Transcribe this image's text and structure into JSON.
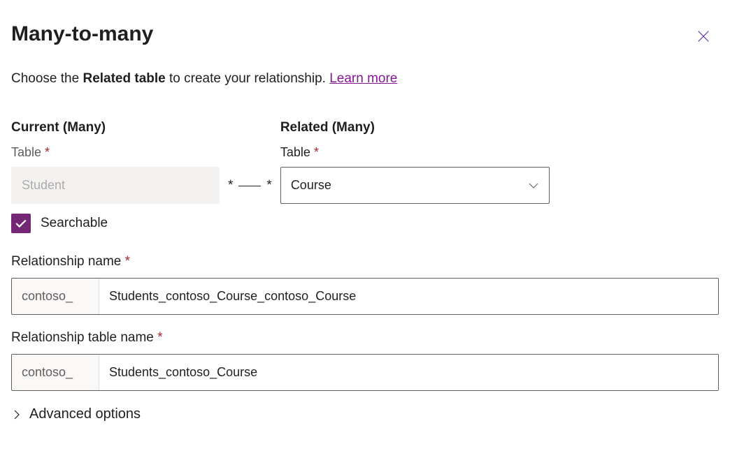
{
  "header": {
    "title": "Many-to-many"
  },
  "description": {
    "prefix": "Choose the ",
    "bold": "Related table",
    "suffix": " to create your relationship. ",
    "link_text": "Learn more"
  },
  "current": {
    "heading": "Current (Many)",
    "table_label": "Table",
    "table_value": "Student"
  },
  "connector": {
    "left_symbol": "*",
    "right_symbol": "*"
  },
  "related": {
    "heading": "Related (Many)",
    "table_label": "Table",
    "table_value": "Course"
  },
  "searchable": {
    "label": "Searchable",
    "checked": true
  },
  "relationship_name": {
    "label": "Relationship name",
    "prefix": "contoso_",
    "value": "Students_contoso_Course_contoso_Course"
  },
  "relationship_table_name": {
    "label": "Relationship table name",
    "prefix": "contoso_",
    "value": "Students_contoso_Course"
  },
  "advanced_options": {
    "label": "Advanced options"
  }
}
